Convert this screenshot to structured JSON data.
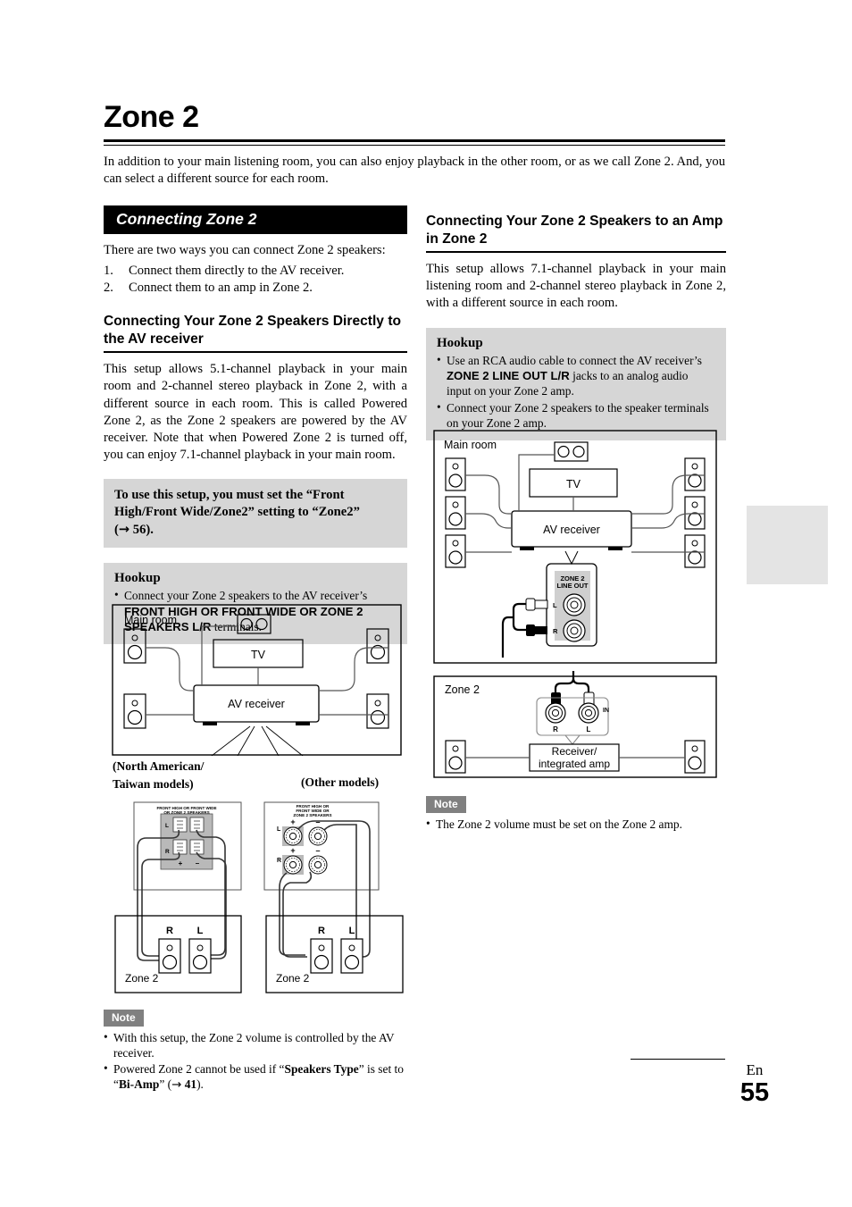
{
  "page": {
    "title": "Zone 2",
    "intro": "In addition to your main listening room, you can also enjoy playback in the other room, or as we call Zone 2. And, you can select a different source for each room.",
    "footer_lang": "En",
    "footer_number": "55"
  },
  "left": {
    "band_heading": "Connecting Zone 2",
    "lead": "There are two ways you can connect Zone 2 speakers:",
    "ways": [
      {
        "num": "1.",
        "text": "Connect them directly to the AV receiver."
      },
      {
        "num": "2.",
        "text": "Connect them to an amp in Zone 2."
      }
    ],
    "subheading": "Connecting Your Zone 2 Speakers Directly to the AV receiver",
    "body": "This setup allows 5.1-channel playback in your main room and 2-channel stereo playback in Zone 2, with a different source in each room. This is called Powered Zone 2, as the Zone 2 speakers are powered by the AV receiver. Note that when Powered Zone 2 is turned off, you can enjoy 7.1-channel playback in your main room.",
    "callout": {
      "part1": "To use this setup, you must set the “Front High/Front Wide/Zone2” setting to “Zone2” (",
      "arrow": "→",
      "page": "56",
      "part2": ").",
      "bg": "#d6d6d6"
    },
    "hookup": {
      "title": "Hookup",
      "items": [
        {
          "pre": "Connect your Zone 2 speakers to the AV receiver’s ",
          "bold": "FRONT HIGH OR FRONT WIDE OR ZONE 2 SPEAKERS L/R",
          "post": " terminals."
        }
      ]
    },
    "note": {
      "badge": "Note",
      "items": [
        {
          "text": "With this setup, the Zone 2 volume is controlled by the AV receiver."
        },
        {
          "pre": "Powered Zone 2 cannot be used if “",
          "bold1": "Speakers Type",
          "mid": "” is set to “",
          "bold2": "Bi-Amp",
          "mid2": "” (",
          "arrow": "→",
          "page": "41",
          "post": ")."
        }
      ]
    },
    "diagram": {
      "main_room_label": "Main room",
      "tv_label": "TV",
      "receiver_label": "AV receiver",
      "model_label_na": "(North American/ Taiwan models)",
      "model_label_na_line1": "(North American/",
      "model_label_na_line2": "Taiwan models)",
      "model_label_other": "(Other models)",
      "terminal_caption_na_line1": "FRONT HIGH OR FRONT WIDE",
      "terminal_caption_na_line2": "OR ZONE 2 SPEAKERS",
      "terminal_caption_other_line1": "FRONT HIGH OR",
      "terminal_caption_other_line2": "FRONT WIDE OR",
      "terminal_caption_other_line3": "ZONE 2 SPEAKERS",
      "label_L": "L",
      "label_R": "R",
      "label_plus": "+",
      "label_minus": "−",
      "zone2_label": "Zone 2",
      "spk_R": "R",
      "spk_L": "L"
    }
  },
  "right": {
    "subheading": "Connecting Your Zone 2 Speakers to an Amp in Zone 2",
    "body": "This setup allows 7.1-channel playback in your main listening room and 2-channel stereo playback in Zone 2, with a different source in each room.",
    "hookup": {
      "title": "Hookup",
      "items": [
        {
          "pre": "Use an RCA audio cable to connect the AV receiver’s ",
          "bold": "ZONE 2 LINE OUT L/R",
          "post": " jacks to an analog audio input on your Zone 2 amp."
        },
        {
          "pre": "Connect your Zone 2 speakers to the speaker terminals on your Zone 2 amp.",
          "bold": "",
          "post": ""
        }
      ]
    },
    "note": {
      "badge": "Note",
      "items": [
        {
          "text": "The Zone 2 volume must be set on the Zone 2 amp."
        }
      ]
    },
    "diagram": {
      "main_room_label": "Main room",
      "tv_label": "TV",
      "receiver_label": "AV receiver",
      "lineout_line1": "ZONE 2",
      "lineout_line2": "LINE OUT",
      "jack_L": "L",
      "jack_R": "R",
      "zone2_label": "Zone 2",
      "in_label": "IN",
      "amp_line1": "Receiver/",
      "amp_line2": "integrated amp",
      "in_R": "R",
      "in_L": "L"
    }
  },
  "colors": {
    "band_bg": "#000000",
    "grey_box": "#d6d6d6",
    "note_badge": "#808080",
    "tab": "#e4e4e4"
  }
}
